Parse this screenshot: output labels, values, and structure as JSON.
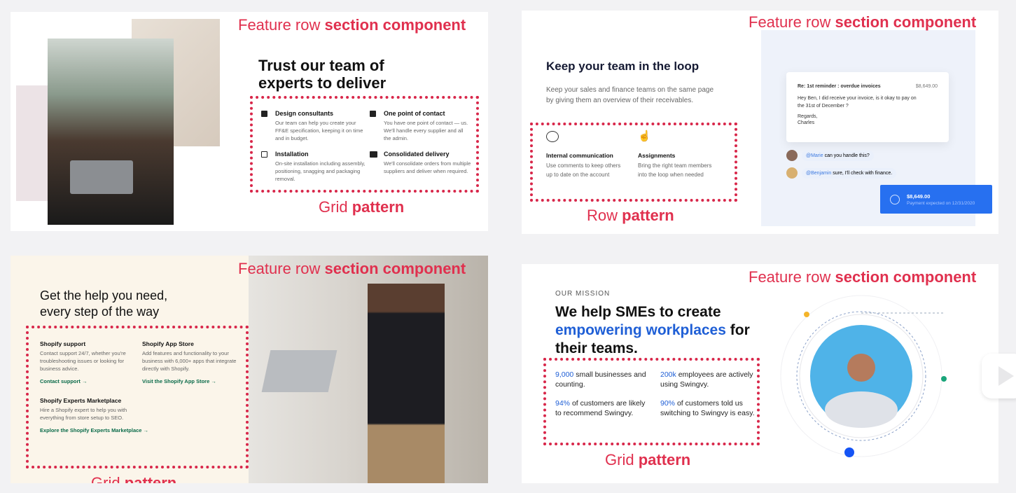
{
  "labels": {
    "component_prefix": "Feature row",
    "component_bold": "section component",
    "grid_prefix": "Grid",
    "row_prefix": "Row",
    "pattern": "pattern"
  },
  "panel1": {
    "title": "Trust our team of experts to deliver",
    "features": [
      {
        "icon": "grid-icon",
        "title": "Design consultants",
        "desc": "Our team can help you create your FF&E specification, keeping it on time and in budget."
      },
      {
        "icon": "id-card-icon",
        "title": "One point of contact",
        "desc": "You have one point of contact — us. We'll handle every supplier and all the admin."
      },
      {
        "icon": "install-icon",
        "title": "Installation",
        "desc": "On-site installation including assembly, positioning, snagging and packaging removal."
      },
      {
        "icon": "truck-icon",
        "title": "Consolidated delivery",
        "desc": "We'll consolidate orders from multiple suppliers and deliver when required."
      }
    ]
  },
  "panel2": {
    "title": "Keep your team in the loop",
    "desc": "Keep your sales and finance teams on the same page by giving them an overview of their receivables.",
    "features": [
      {
        "icon": "chat-bubble-icon",
        "title": "Internal communication",
        "desc": "Use comments to keep others up to date on the account"
      },
      {
        "icon": "pointer-hand-icon",
        "title": "Assignments",
        "desc": "Bring the right team members into the loop when needed"
      }
    ],
    "email": {
      "subject": "Re: 1st reminder : overdue invoices",
      "amount": "$8,649.00",
      "body": "Hey Ben, I did receive your invoice, is it okay to pay on the 31st of December ?",
      "regards": "Regards,",
      "name": "Charles"
    },
    "comments": [
      {
        "mention": "@Marie",
        "text": "can you handle this?"
      },
      {
        "mention": "@Benjamin",
        "text": "sure, I'll check with finance."
      }
    ],
    "payment": {
      "amount": "$8,649.00",
      "note": "Payment expected on 12/31/2020"
    }
  },
  "panel3": {
    "title": "Get the help you need, every step of the way",
    "features": [
      {
        "title": "Shopify support",
        "desc": "Contact support 24/7, whether you're troubleshooting issues or looking for business advice.",
        "link": "Contact support →"
      },
      {
        "title": "Shopify App Store",
        "desc": "Add features and functionality to your business with 6,000+ apps that integrate directly with Shopify.",
        "link": "Visit the Shopify App Store →"
      },
      {
        "title": "Shopify Experts Marketplace",
        "desc": "Hire a Shopify expert to help you with everything from store setup to SEO.",
        "link": "Explore the Shopify Experts Marketplace →"
      }
    ]
  },
  "panel4": {
    "eyebrow": "OUR MISSION",
    "title_a": "We help SMEs to create",
    "title_accent": "empowering workplaces",
    "title_b": "for",
    "title_c": "their teams.",
    "stats": [
      {
        "value": "9,000",
        "text": "small businesses and counting."
      },
      {
        "value": "200k",
        "text": "employees are actively using Swingvy."
      },
      {
        "value": "94%",
        "text": "of customers are likely to recommend Swingvy."
      },
      {
        "value": "90%",
        "text": "of customers told us switching to Swingvy is easy."
      }
    ]
  },
  "colors": {
    "annotation": "#e0304e",
    "accent_blue": "#1f5fd6",
    "shopify_green": "#0b6b4a",
    "payment_blue": "#2770f0"
  }
}
